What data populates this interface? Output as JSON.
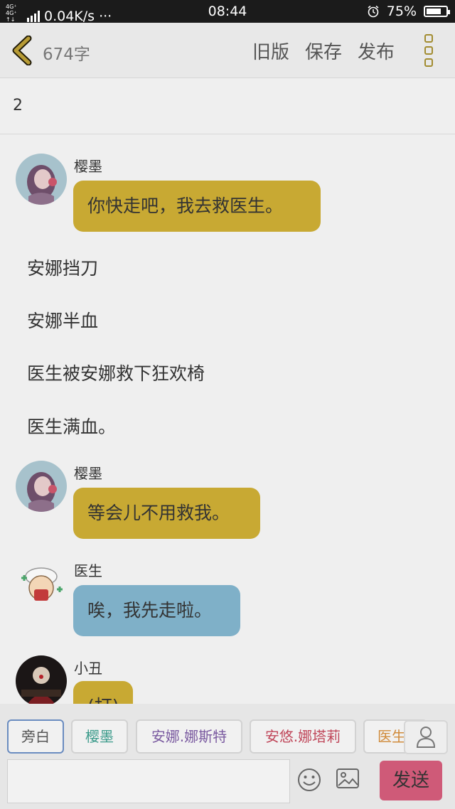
{
  "status_bar": {
    "network_top": "4G⁺ 4G⁺",
    "network_bottom": "↑↓ 2G",
    "speed": "0.04K/s",
    "dots": "···",
    "time": "08:44",
    "battery": "75%",
    "battery_level": 0.75
  },
  "header": {
    "word_count": "674字",
    "old_version": "旧版",
    "save": "保存",
    "publish": "发布"
  },
  "chapter": {
    "title": "2"
  },
  "messages": [
    {
      "speaker": "樱墨",
      "text": "你快走吧，我去救医生。"
    },
    {
      "speaker": "樱墨",
      "text": "等会儿不用救我。"
    },
    {
      "speaker": "医生",
      "text": "唉，我先走啦。"
    },
    {
      "speaker": "小丑",
      "text": "(打)"
    }
  ],
  "narrations": [
    "安娜挡刀",
    "安娜半血",
    "医生被安娜救下狂欢椅",
    "医生满血。"
  ],
  "roles": [
    {
      "label": "旁白",
      "color": "#555555"
    },
    {
      "label": "樱墨",
      "color": "#3a9a8a"
    },
    {
      "label": "安娜.娜斯特",
      "color": "#7a5aa0"
    },
    {
      "label": "安悠.娜塔莉",
      "color": "#c0475a"
    },
    {
      "label": "医生",
      "color": "#d08a3a"
    }
  ],
  "colors": {
    "yellow_bubble": "#c8a933",
    "blue_bubble": "#7fb0c8",
    "send": "#cf5a78",
    "accent": "#a28c30"
  },
  "icons": {
    "back": "chevron-left-icon",
    "menu": "vertical-dots-icon",
    "emoji": "smiley-icon",
    "image": "image-icon",
    "person": "person-icon"
  },
  "send_label": "发送"
}
